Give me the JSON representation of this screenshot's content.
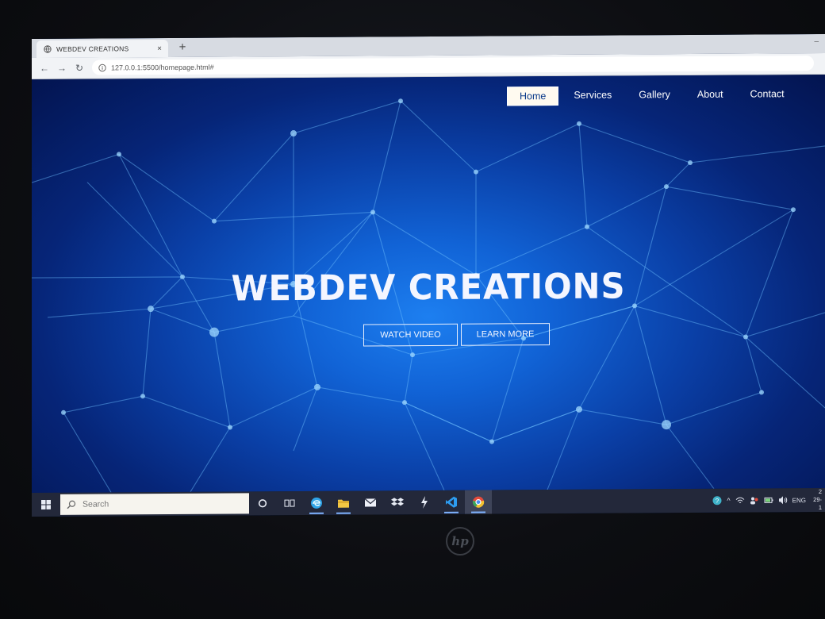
{
  "browser": {
    "tab_title": "WEBDEV CREATIONS",
    "tab_close": "×",
    "new_tab": "+",
    "url": "127.0.0.1:5500/homepage.html#"
  },
  "site": {
    "nav": [
      "Home",
      "Services",
      "Gallery",
      "About",
      "Contact"
    ],
    "active_nav": "Home",
    "title": "WEBDEV CREATIONS",
    "buttons": {
      "watch": "WATCH VIDEO",
      "learn": "LEARN MORE"
    }
  },
  "taskbar": {
    "search_placeholder": "Search",
    "language": "ENG",
    "clock_line1": "2",
    "clock_line2": "29-1"
  },
  "device": {
    "brand_logo": "hp"
  },
  "colors": {
    "hero_center": "#1d7ff0",
    "hero_edge": "#031450",
    "taskbar": "#23283a",
    "accent": "#7fb3ff"
  }
}
